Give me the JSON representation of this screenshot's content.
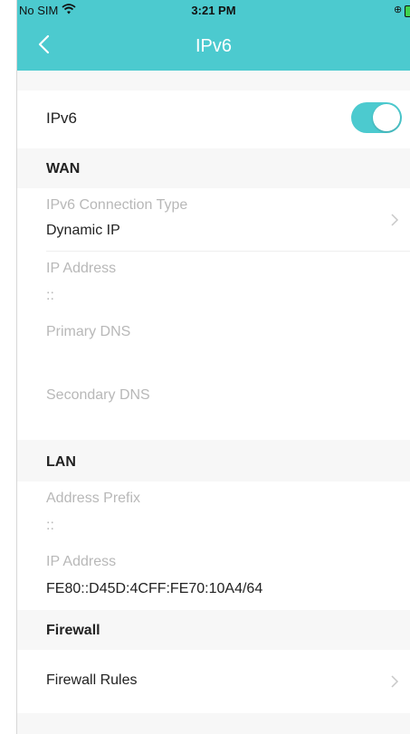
{
  "status_bar": {
    "carrier": "No SIM",
    "time": "3:21 PM"
  },
  "header": {
    "title": "IPv6"
  },
  "ipv6_toggle": {
    "label": "IPv6",
    "enabled": true
  },
  "wan": {
    "heading": "WAN",
    "connection_type_label": "IPv6 Connection Type",
    "connection_type_value": "Dynamic IP",
    "ip_address_label": "IP Address",
    "ip_address_value": "::",
    "primary_dns_label": "Primary DNS",
    "secondary_dns_label": "Secondary DNS"
  },
  "lan": {
    "heading": "LAN",
    "address_prefix_label": "Address Prefix",
    "address_prefix_value": "::",
    "ip_address_label": "IP Address",
    "ip_address_value": "FE80::D45D:4CFF:FE70:10A4/64"
  },
  "firewall": {
    "heading": "Firewall",
    "rules_label": "Firewall Rules"
  },
  "colors": {
    "accent": "#4ccacf",
    "section_bg": "#f7f7f7",
    "muted_text": "#b8b8b8"
  }
}
